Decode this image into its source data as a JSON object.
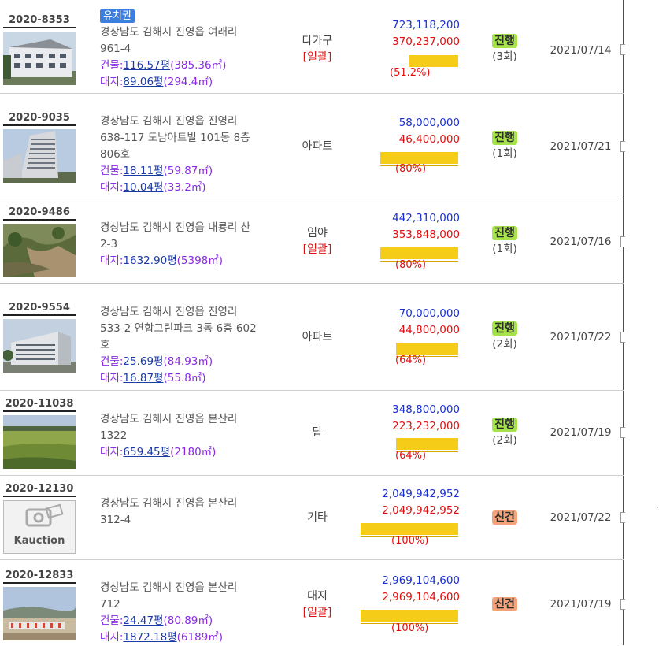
{
  "listings": [
    {
      "case_no": "2020-8353",
      "tag": "유치권",
      "address": [
        "경상남도 김해시 진영읍 여래리",
        "961-4"
      ],
      "building_label": "건물:",
      "building_pyeong": "116.57평",
      "building_m2": "(385.36㎡)",
      "land_label": "대지:",
      "land_pyeong": "89.06평",
      "land_m2": "(294.4㎡)",
      "type": "다가구",
      "type_note": "[일괄]",
      "appraised": "723,118,200",
      "minimum": "370,237,000",
      "ratio": "(51.2%)",
      "ratio_value": 51.2,
      "status": "진행",
      "rounds": "(3회)",
      "date": "2021/07/14"
    },
    {
      "case_no": "2020-9035",
      "address": [
        "경상남도 김해시 진영읍 진영리",
        "638-117 도남아트빌 101동 8층",
        "806호"
      ],
      "building_label": "건물:",
      "building_pyeong": "18.11평",
      "building_m2": "(59.87㎡)",
      "land_label": "대지:",
      "land_pyeong": "10.04평",
      "land_m2": "(33.2㎡)",
      "type": "아파트",
      "appraised": "58,000,000",
      "minimum": "46,400,000",
      "ratio": "(80%)",
      "ratio_value": 80,
      "status": "진행",
      "rounds": "(1회)",
      "date": "2021/07/21"
    },
    {
      "case_no": "2020-9486",
      "address": [
        "경상남도 김해시 진영읍 내룡리 산",
        "2-3"
      ],
      "land_label": "대지:",
      "land_pyeong": "1632.90평",
      "land_m2": "(5398㎡)",
      "type": "임야",
      "type_note": "[일괄]",
      "appraised": "442,310,000",
      "minimum": "353,848,000",
      "ratio": "(80%)",
      "ratio_value": 80,
      "status": "진행",
      "rounds": "(1회)",
      "date": "2021/07/16"
    },
    {
      "case_no": "2020-9554",
      "address": [
        "경상남도 김해시 진영읍 진영리",
        "533-2 연합그린파크 3동 6층 602",
        "호"
      ],
      "building_label": "건물:",
      "building_pyeong": "25.69평",
      "building_m2": "(84.93㎡)",
      "land_label": "대지:",
      "land_pyeong": "16.87평",
      "land_m2": "(55.8㎡)",
      "type": "아파트",
      "appraised": "70,000,000",
      "minimum": "44,800,000",
      "ratio": "(64%)",
      "ratio_value": 64,
      "status": "진행",
      "rounds": "(2회)",
      "date": "2021/07/22"
    },
    {
      "case_no": "2020-11038",
      "address": [
        "경상남도 김해시 진영읍 본산리",
        "1322"
      ],
      "land_label": "대지:",
      "land_pyeong": "659.45평",
      "land_m2": "(2180㎡)",
      "type": "답",
      "appraised": "348,800,000",
      "minimum": "223,232,000",
      "ratio": "(64%)",
      "ratio_value": 64,
      "status": "진행",
      "rounds": "(2회)",
      "date": "2021/07/19"
    },
    {
      "case_no": "2020-12130",
      "address": [
        "경상남도 김해시 진영읍 본산리",
        "312-4"
      ],
      "type": "기타",
      "logo_text": "Kauction",
      "appraised": "2,049,942,952",
      "minimum": "2,049,942,952",
      "ratio": "(100%)",
      "ratio_value": 100,
      "status": "신건",
      "date": "2021/07/22"
    },
    {
      "case_no": "2020-12833",
      "address": [
        "경상남도 김해시 진영읍 본산리",
        "712"
      ],
      "building_label": "건물:",
      "building_pyeong": "24.47평",
      "building_m2": "(80.89㎡)",
      "land_label": "대지:",
      "land_pyeong": "1872.18평",
      "land_m2": "(6189㎡)",
      "type": "대지",
      "type_note": "[일괄]",
      "appraised": "2,969,104,600",
      "minimum": "2,969,104,600",
      "ratio": "(100%)",
      "ratio_value": 100,
      "status": "신건",
      "date": "2021/07/19"
    }
  ],
  "colors": {
    "appraised": "#1a2fd0",
    "minimum": "#e01010",
    "bar": "#f5cd18",
    "status_active": "#a6e34a",
    "status_new": "#f4a27a",
    "tag": "#3c7fe0"
  }
}
